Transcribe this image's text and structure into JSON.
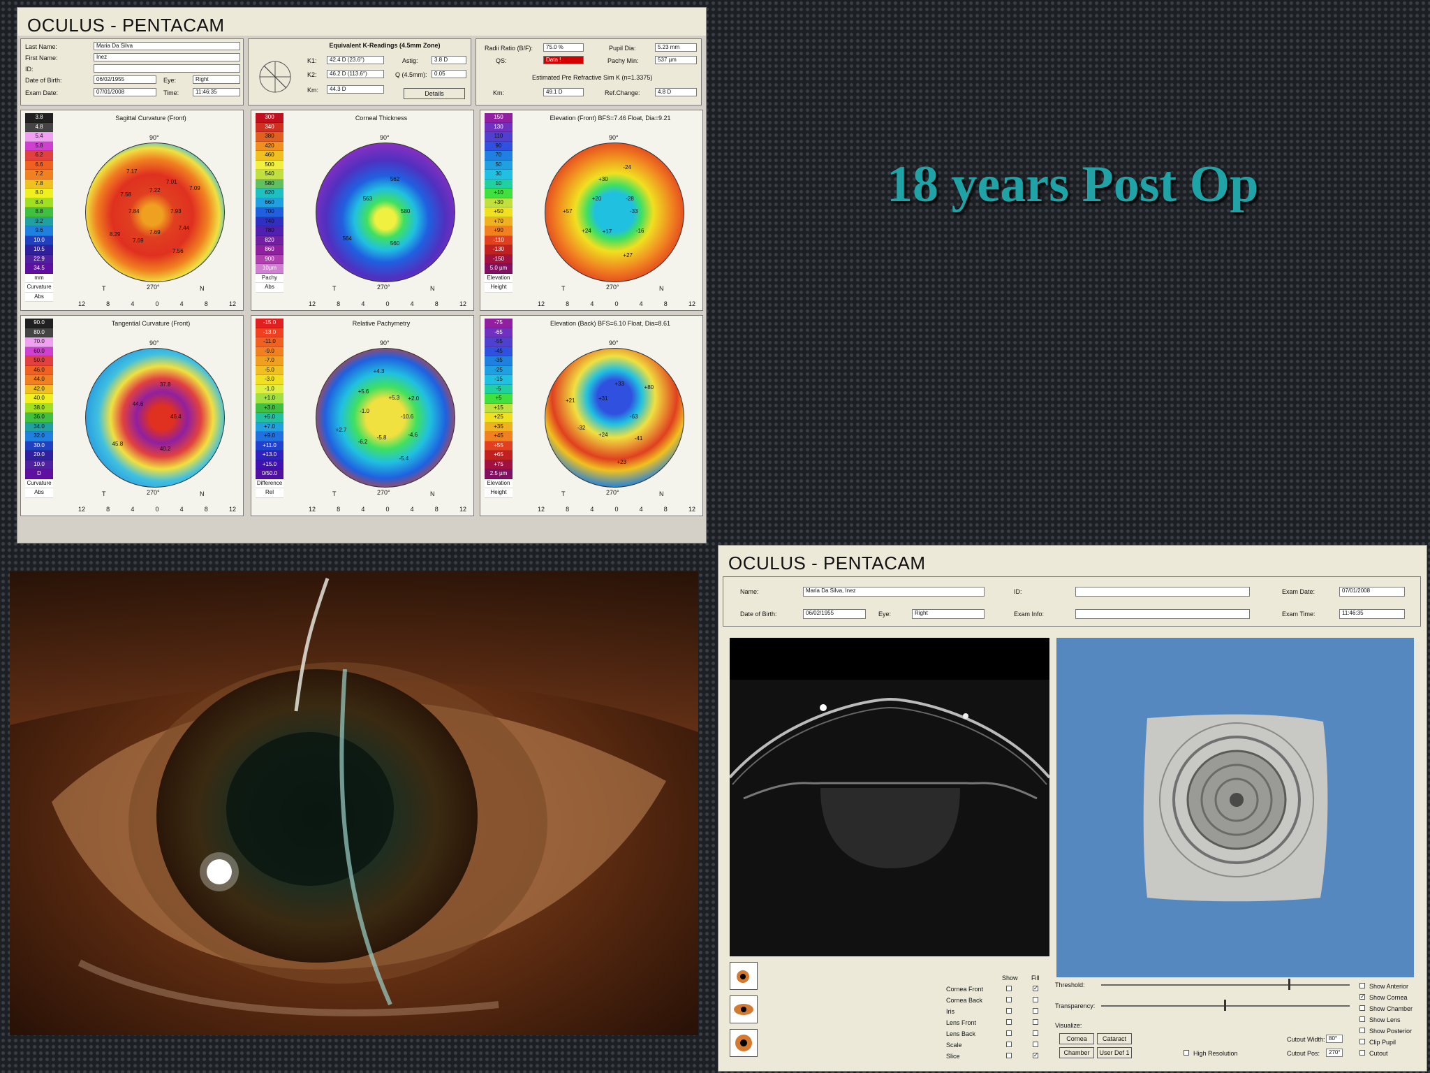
{
  "slide_title": "18 years Post Op",
  "top_panel": {
    "title": "OCULUS  -  PENTACAM",
    "patient": {
      "last_name_label": "Last Name:",
      "last_name": "Maria Da Silva",
      "first_name_label": "First Name:",
      "first_name": "Inez",
      "id_label": "ID:",
      "id": "",
      "dob_label": "Date of Birth:",
      "dob": "06/02/1955",
      "eye_label": "Eye:",
      "eye": "Right",
      "exam_date_label": "Exam Date:",
      "exam_date": "07/01/2008",
      "time_label": "Time:",
      "time": "11:46:35"
    },
    "kreadings": {
      "title": "Equivalent K-Readings (4.5mm Zone)",
      "k1_label": "K1:",
      "k1": "42.4 D (23.6°)",
      "k2_label": "K2:",
      "k2": "46.2 D (113.6°)",
      "km_label": "Km:",
      "km": "44.3 D",
      "astig_label": "Astig:",
      "astig": "3.8 D",
      "q_label": "Q (4.5mm):",
      "q": "0.05",
      "details_button": "Details"
    },
    "ratios": {
      "radii_label": "Radii Ratio (B/F):",
      "radii": "75.0 %",
      "pupil_label": "Pupil Dia:",
      "pupil": "5.23 mm",
      "qs_label": "QS:",
      "qs": "Data !",
      "pachy_label": "Pachy Min:",
      "pachy": "537 µm",
      "est_title": "Estimated Pre Refractive Sim K (n=1.3375)",
      "km_label": "Km:",
      "km": "49.1 D",
      "refchange_label": "Ref.Change:",
      "refchange": "4.8 D"
    },
    "maps": [
      {
        "title": "Sagittal Curvature (Front)",
        "scale": [
          "3.8",
          "4.8",
          "5.4",
          "5.8",
          "6.2",
          "6.6",
          "7.2",
          "7.8",
          "8.0",
          "8.4",
          "8.8",
          "9.2",
          "9.6",
          "10.0",
          "10.5",
          "22.9",
          "34.5",
          "mm"
        ],
        "scale_foot": [
          "Curvature",
          "Abs"
        ]
      },
      {
        "title": "Corneal Thickness",
        "scale": [
          "300",
          "340",
          "380",
          "420",
          "460",
          "500",
          "540",
          "580",
          "620",
          "660",
          "700",
          "740",
          "780",
          "820",
          "860",
          "900",
          "10µm",
          "Pachy"
        ],
        "scale_foot": [
          "Abs"
        ]
      },
      {
        "title": "Elevation (Front)  BFS=7.46 Float, Dia=9.21",
        "scale": [
          "150",
          "130",
          "110",
          "90",
          "70",
          "50",
          "30",
          "10",
          "+10",
          "+30",
          "+50",
          "+70",
          "+90",
          "-110",
          "-130",
          "-150",
          "5.0 µm"
        ],
        "scale_foot": [
          "Elevation",
          "Height"
        ]
      },
      {
        "title": "Tangential Curvature (Front)",
        "scale": [
          "90.0",
          "80.0",
          "70.0",
          "60.0",
          "50.0",
          "46.0",
          "44.0",
          "42.0",
          "40.0",
          "38.0",
          "36.0",
          "34.0",
          "32.0",
          "30.0",
          "20.0",
          "10.0",
          "D"
        ],
        "scale_foot": [
          "Curvature",
          "Abs"
        ]
      },
      {
        "title": "Relative Pachymetry",
        "scale": [
          "-15.0",
          "-13.0",
          "-11.0",
          "-9.0",
          "-7.0",
          "-5.0",
          "-3.0",
          "-1.0",
          "+1.0",
          "+3.0",
          "+5.0",
          "+7.0",
          "+9.0",
          "+11.0",
          "+13.0",
          "+15.0",
          "0/50.0"
        ],
        "scale_foot": [
          "Difference",
          "Rel"
        ]
      },
      {
        "title": "Elevation (Back)  BFS=6.10 Float, Dia=8.61",
        "scale": [
          "-75",
          "-65",
          "-55",
          "-45",
          "-35",
          "-25",
          "-15",
          "-5",
          "+5",
          "+15",
          "+25",
          "+35",
          "+45",
          "+55",
          "+65",
          "+75",
          "2.5 µm"
        ],
        "scale_foot": [
          "Elevation",
          "Height"
        ]
      }
    ],
    "axis_ticks": [
      "12",
      "8",
      "4",
      "0",
      "4",
      "8",
      "12"
    ],
    "orient": {
      "top": "90°",
      "left": "T",
      "right": "N",
      "bottom": "270°"
    },
    "map_values": [
      [
        "7.93",
        "7.44",
        "7.56",
        "7.69",
        "7.69",
        "8.29",
        "7.84",
        "7.58",
        "7.17",
        "7.22",
        "7.01",
        "7.09"
      ],
      [
        "580",
        "560",
        "564",
        "563",
        "562"
      ],
      [
        "-33",
        "-16",
        "+27",
        "+17",
        "+24",
        "+57",
        "+20",
        "+30",
        "-24",
        "-28"
      ],
      [
        "46.4",
        "40.2",
        "45.8",
        "44.6",
        "37.8"
      ],
      [
        "-10.6",
        "-4.6",
        "-5.4",
        "-5.8",
        "-6.2",
        "+2.7",
        "-1.0",
        "+5.6",
        "+4.3",
        "+5.3",
        "+2.0"
      ],
      [
        "-63",
        "-41",
        "+23",
        "+24",
        "-32",
        "+21",
        "+31",
        "+33",
        "+80"
      ]
    ]
  },
  "bottom_panel": {
    "title": "OCULUS  -  PENTACAM",
    "name_label": "Name:",
    "name": "Maria Da Silva, Inez",
    "id_label": "ID:",
    "id": "",
    "exam_date_label": "Exam Date:",
    "exam_date": "07/01/2008",
    "dob_label": "Date of Birth:",
    "dob": "06/02/1955",
    "eye_label": "Eye:",
    "eye": "Right",
    "exam_info_label": "Exam Info:",
    "exam_info": "",
    "exam_time_label": "Exam Time:",
    "exam_time": "11:46:35",
    "show_label": "Show",
    "fill_label": "Fill",
    "layers": [
      "Cornea Front",
      "Cornea Back",
      "Iris",
      "Lens Front",
      "Lens Back",
      "Scale",
      "Slice"
    ],
    "threshold_label": "Threshold:",
    "transparency_label": "Transparency:",
    "visualize_label": "Visualize:",
    "cornea_btn": "Cornea",
    "cataract_btn": "Cataract",
    "chamber_btn": "Chamber",
    "userdef_btn": "User Def 1",
    "highres_label": "High Resolution",
    "cutout_width_label": "Cutout Width:",
    "cutout_width": "80°",
    "cutout_pos_label": "Cutout Pos:",
    "cutout_pos": "270°",
    "options": [
      "Show Anterior",
      "Show Cornea",
      "Show Chamber",
      "Show Lens",
      "Show Posterior",
      "Clip Pupil",
      "Cutout"
    ]
  }
}
